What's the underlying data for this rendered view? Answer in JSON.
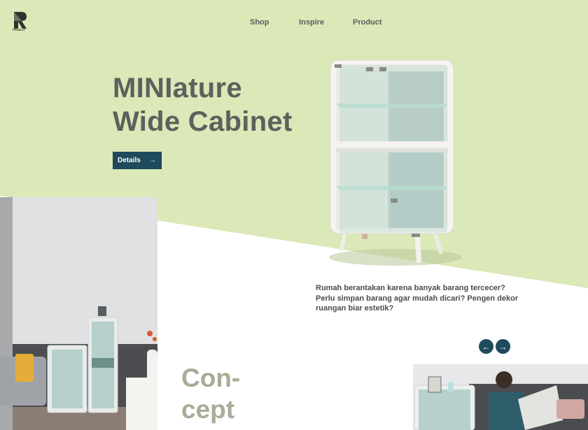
{
  "brand": {
    "logo_text": "PRABOT",
    "logo_icon": "r-lettermark-icon"
  },
  "nav": {
    "items": [
      "Shop",
      "Inspire",
      "Product"
    ]
  },
  "hero": {
    "title_line1": "MINIature",
    "title_line2": "Wide Cabinet",
    "details_label": "Details",
    "details_arrow": "→"
  },
  "blurb": {
    "text": "Rumah berantakan karena banyak barang tercecer? Perlu simpan barang agar mudah dicari? Pengen dekor ruangan biar estetik?"
  },
  "carousel": {
    "prev_arrow": "←",
    "next_arrow": "→"
  },
  "concept": {
    "line1": "Con-",
    "line2": "cept"
  },
  "colors": {
    "hero_green": "#dbe8b7",
    "accent_navy": "#1f4a5c",
    "concept_text": "#a7ad97",
    "title_text": "#5e605d"
  }
}
